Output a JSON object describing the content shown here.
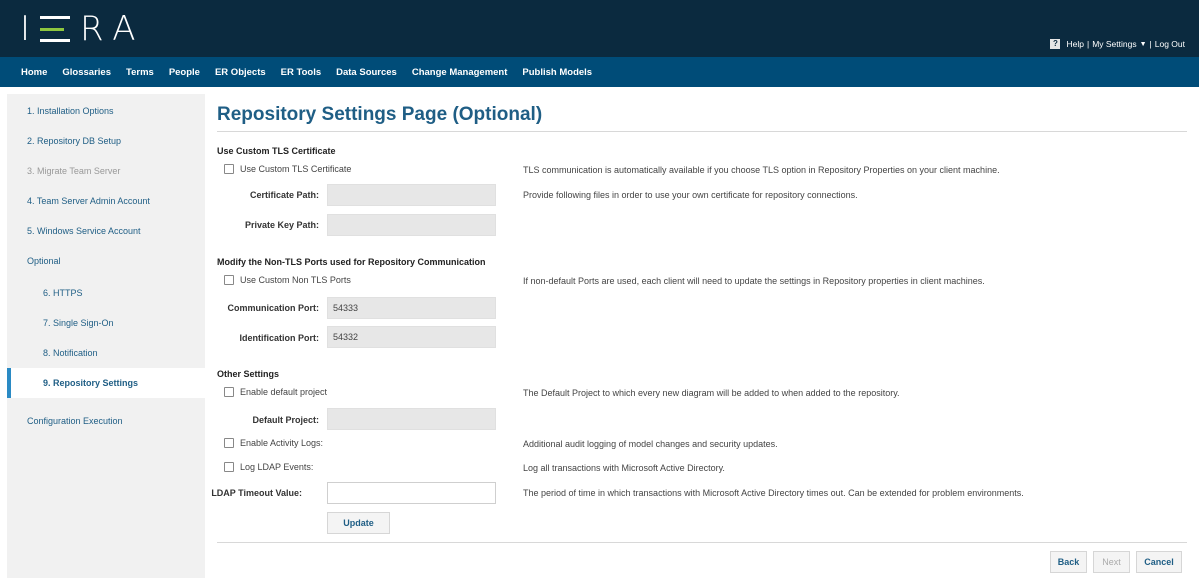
{
  "header": {
    "logo_text": "IDERA",
    "help_icon_glyph": "?",
    "help_label": "Help",
    "separator": "|",
    "settings_label": "My Settings",
    "caret_glyph": "▼",
    "logout_label": "Log Out"
  },
  "nav": {
    "items": [
      "Home",
      "Glossaries",
      "Terms",
      "People",
      "ER Objects",
      "ER Tools",
      "Data Sources",
      "Change Management",
      "Publish Models"
    ]
  },
  "sidebar": {
    "items": [
      "1. Installation Options",
      "2. Repository DB Setup",
      "3. Migrate Team Server",
      "4. Team Server Admin Account",
      "5. Windows Service Account",
      "Optional",
      "6. HTTPS",
      "7. Single Sign-On",
      "8. Notification",
      "9. Repository Settings",
      "Configuration Execution"
    ]
  },
  "page": {
    "title": "Repository Settings Page (Optional)",
    "tls": {
      "heading": "Use Custom TLS Certificate",
      "checkbox_label": "Use Custom TLS Certificate",
      "checkbox_desc": "TLS communication is automatically available if you choose TLS option in Repository Properties on your client machine.",
      "cert_path_label": "Certificate Path:",
      "cert_path_value": "",
      "cert_desc": "Provide following files in order to use your own certificate for repository connections.",
      "key_path_label": "Private Key Path:",
      "key_path_value": ""
    },
    "ports": {
      "heading": "Modify the Non-TLS Ports used for Repository Communication",
      "checkbox_label": "Use Custom Non TLS Ports",
      "checkbox_desc": "If non-default Ports are used, each client will need to update the settings in Repository properties in client machines.",
      "comm_label": "Communication Port:",
      "comm_value": "54333",
      "ident_label": "Identification Port:",
      "ident_value": "54332"
    },
    "other": {
      "heading": "Other Settings",
      "default_project_checkbox": "Enable default project",
      "default_project_desc": "The Default Project to which every new diagram will be added to when added to the repository.",
      "default_project_label": "Default Project:",
      "default_project_value": "",
      "activity_logs_checkbox": "Enable Activity Logs:",
      "activity_logs_desc": "Additional audit logging of model changes and security updates.",
      "ldap_events_checkbox": "Log LDAP Events:",
      "ldap_events_desc": "Log all transactions with Microsoft Active Directory.",
      "ldap_timeout_label": "LDAP Timeout Value:",
      "ldap_timeout_value": "",
      "ldap_timeout_desc": "The period of time in which transactions with Microsoft Active Directory times out. Can be extended for problem environments.",
      "update_button": "Update"
    },
    "footer": {
      "back_button": "Back",
      "next_button": "Next",
      "cancel_button": "Cancel"
    }
  }
}
